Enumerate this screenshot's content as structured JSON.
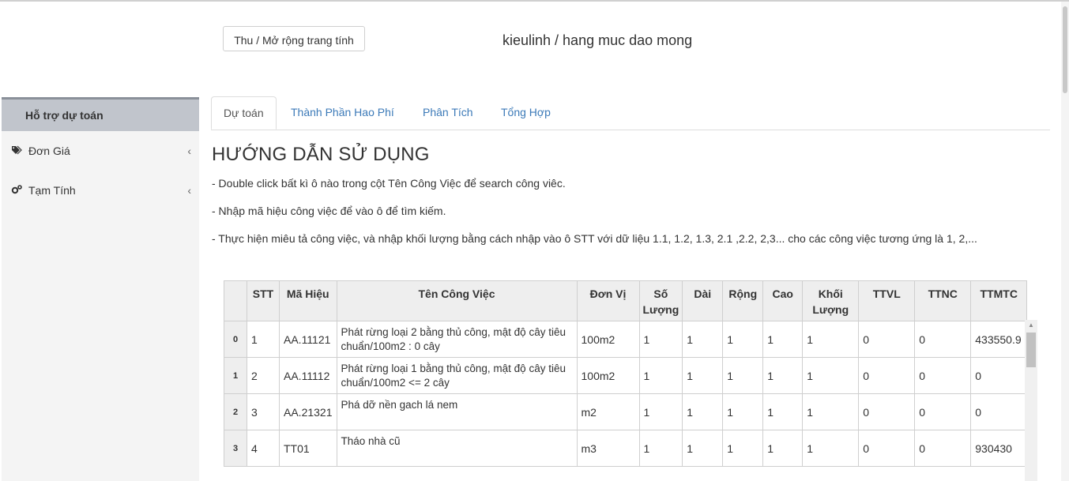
{
  "toolbar": {
    "collapse_label": "Thu / Mở rộng trang tính",
    "sheet_title": "kieulinh / hang muc dao mong"
  },
  "sidebar": {
    "header": "Hỗ trợ dự toán",
    "items": [
      {
        "label": "Đơn Giá",
        "icon": "tag-icon"
      },
      {
        "label": "Tạm Tính",
        "icon": "cogs-icon"
      }
    ]
  },
  "tabs": [
    "Dự toán",
    "Thành Phần Hao Phí",
    "Phân Tích",
    "Tổng Hợp"
  ],
  "guide": {
    "title": "HƯỚNG DẪN SỬ DỤNG",
    "lines": [
      "- Double click bất kì ô nào trong cột Tên Công Việc để search công viêc.",
      "- Nhập mã hiệu công việc để vào ô để tìm kiếm.",
      "- Thực hiện miêu tả công việc, và nhập khối lượng bằng cách nhập vào ô STT với dữ liệu 1.1, 1.2, 1.3, 2.1 ,2.2, 2,3... cho các công việc tương ứng là 1, 2,..."
    ]
  },
  "table": {
    "headers": [
      "STT",
      "Mã Hiệu",
      "Tên Công Việc",
      "Đơn Vị",
      "Số Lượng",
      "Dài",
      "Rộng",
      "Cao",
      "Khối Lượng",
      "TTVL",
      "TTNC",
      "TTMTC"
    ],
    "rows": [
      {
        "idx": "0",
        "cells": [
          "1",
          "AA.11121",
          "Phát rừng loại 2 bằng thủ công, mật độ cây tiêu chuẩn/100m2 :  0 cây",
          "100m2",
          "1",
          "1",
          "1",
          "1",
          "1",
          "0",
          "0",
          "433550.9"
        ]
      },
      {
        "idx": "1",
        "cells": [
          "2",
          "AA.11112",
          "Phát rừng loại 1 bằng thủ công, mật độ cây tiêu chuẩn/100m2 <= 2 cây",
          "100m2",
          "1",
          "1",
          "1",
          "1",
          "1",
          "0",
          "0",
          "0"
        ]
      },
      {
        "idx": "2",
        "cells": [
          "3",
          "AA.21321",
          "Phá dỡ nền gach lá nem",
          "m2",
          "1",
          "1",
          "1",
          "1",
          "1",
          "0",
          "0",
          "0"
        ]
      },
      {
        "idx": "3",
        "cells": [
          "4",
          "TT01",
          "Tháo nhà cũ",
          "m3",
          "1",
          "1",
          "1",
          "1",
          "1",
          "0",
          "0",
          "930430"
        ]
      }
    ]
  }
}
